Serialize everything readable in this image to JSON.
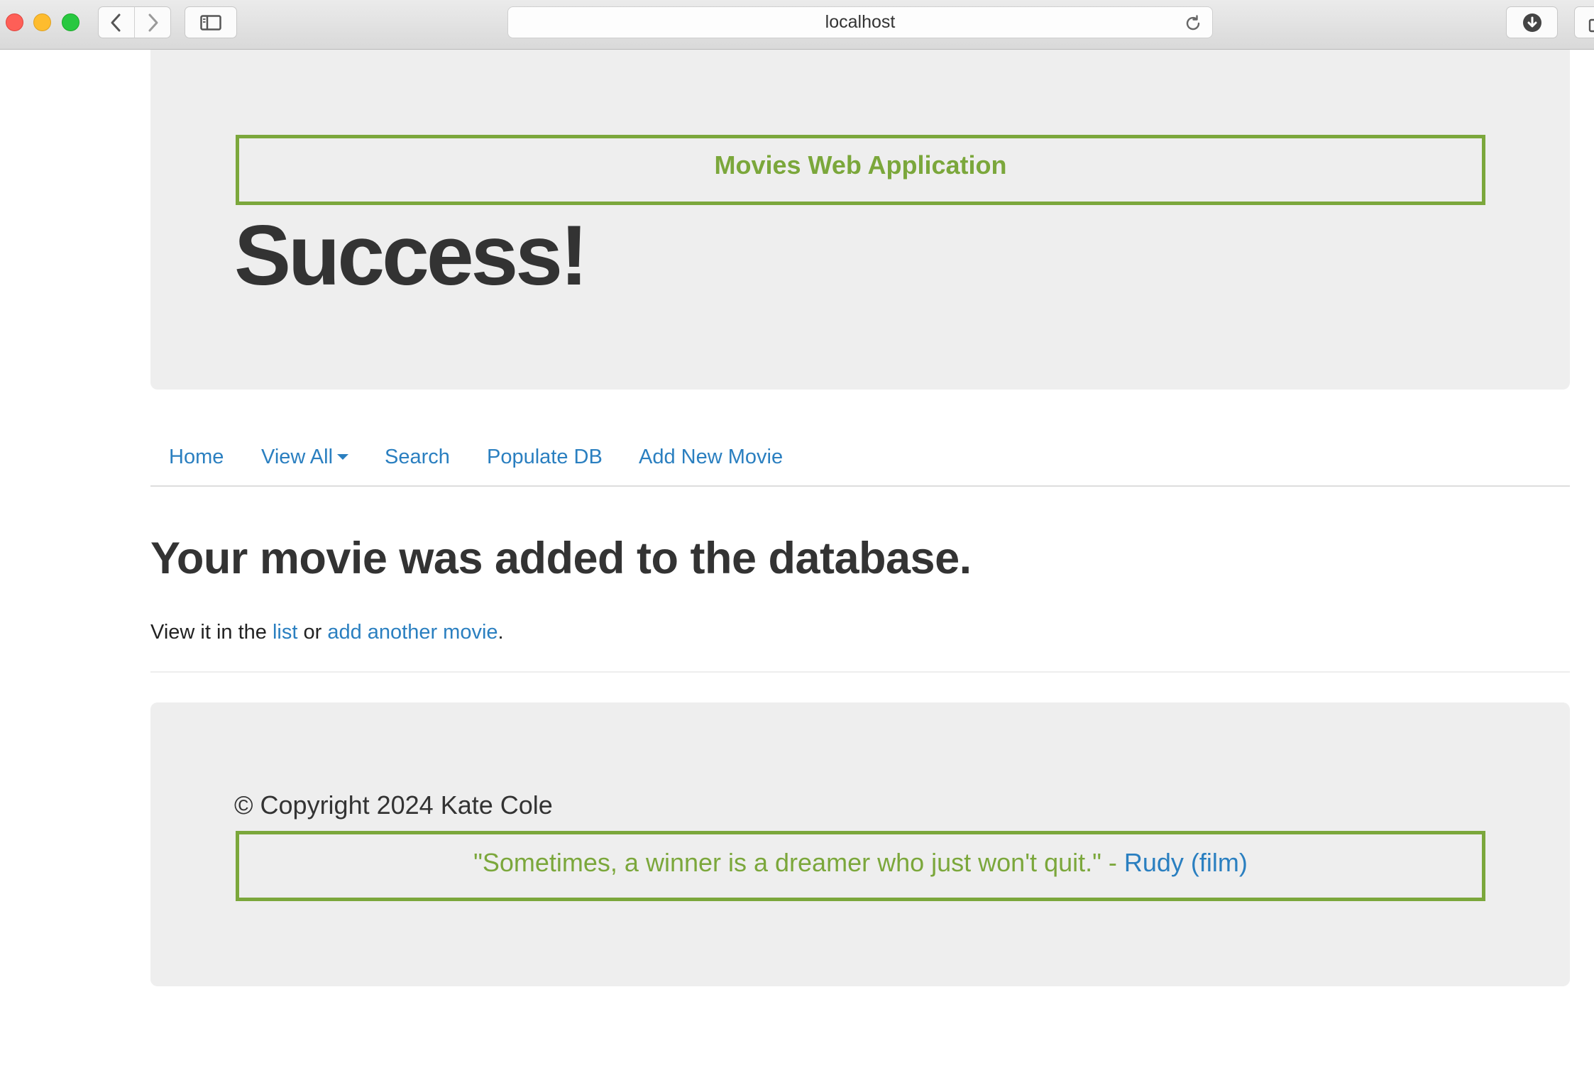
{
  "browser": {
    "address": "localhost",
    "icons": {
      "back": "chevron-left-icon",
      "forward": "chevron-right-icon",
      "sidebar": "sidebar-icon",
      "reload": "reload-icon",
      "download": "download-icon",
      "share": "share-icon"
    }
  },
  "header": {
    "brand": "Movies Web Application",
    "title": "Success!"
  },
  "nav": {
    "items": [
      {
        "label": "Home"
      },
      {
        "label": "View All"
      },
      {
        "label": "Search"
      },
      {
        "label": "Populate DB"
      },
      {
        "label": "Add New Movie"
      }
    ]
  },
  "main": {
    "heading": "Your movie was added to the database.",
    "text_before": "View it in the ",
    "list_link": "list",
    "text_middle": " or ",
    "add_link": "add another movie",
    "text_after": "."
  },
  "footer": {
    "copyright": "© Copyright 2024 Kate Cole",
    "quote": "\"Sometimes, a winner is a dreamer who just won't quit.\" - ",
    "quote_source": "Rudy (film)"
  },
  "colors": {
    "accent_green": "#7ba73b",
    "link_blue": "#2a7fc0",
    "panel_gray": "#eeeeee",
    "text_dark": "#333333"
  }
}
